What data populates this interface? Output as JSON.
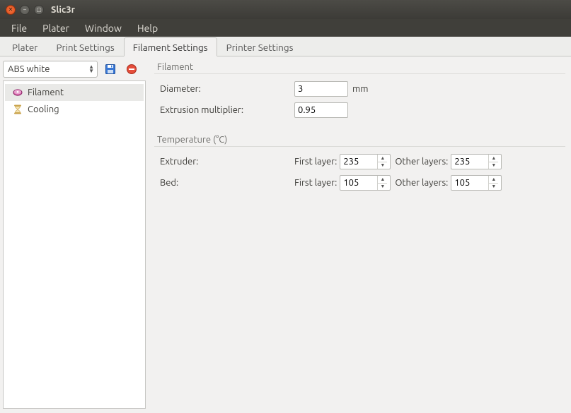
{
  "window": {
    "title": "Slic3r"
  },
  "menubar": {
    "items": [
      "File",
      "Plater",
      "Window",
      "Help"
    ]
  },
  "tabs": [
    {
      "label": "Plater",
      "active": false
    },
    {
      "label": "Print Settings",
      "active": false
    },
    {
      "label": "Filament Settings",
      "active": true
    },
    {
      "label": "Printer Settings",
      "active": false
    }
  ],
  "preset": {
    "selected": "ABS white"
  },
  "tree": {
    "items": [
      {
        "label": "Filament",
        "icon": "spool",
        "selected": true
      },
      {
        "label": "Cooling",
        "icon": "hourglass",
        "selected": false
      }
    ]
  },
  "groups": {
    "filament": {
      "title": "Filament",
      "diameter_label": "Diameter:",
      "diameter_value": "3",
      "diameter_unit": "mm",
      "multiplier_label": "Extrusion multiplier:",
      "multiplier_value": "0.95"
    },
    "temperature": {
      "title": "Temperature (°C)",
      "extruder_label": "Extruder:",
      "bed_label": "Bed:",
      "first_layer_label": "First layer:",
      "other_layers_label": "Other layers:",
      "extruder_first": "235",
      "extruder_other": "235",
      "bed_first": "105",
      "bed_other": "105"
    }
  }
}
